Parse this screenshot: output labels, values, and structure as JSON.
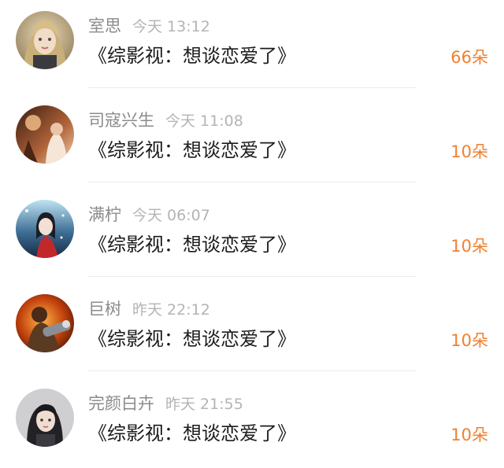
{
  "colors": {
    "name": "#8b8b8b",
    "time": "#b4b4b4",
    "title": "#1c1c1c",
    "gift_count": "#f08030",
    "divider": "#ececec"
  },
  "rows": [
    {
      "name": "室思",
      "time": "今天 13:12",
      "title": "《综影视：想谈恋爱了》",
      "gift": "66朵",
      "avatar_icon": "fantasy-girl-avatar-icon"
    },
    {
      "name": "司寇兴生",
      "time": "今天 11:08",
      "title": "《综影视：想谈恋爱了》",
      "gift": "10朵",
      "avatar_icon": "warm-scene-avatar-icon"
    },
    {
      "name": "满柠",
      "time": "今天 06:07",
      "title": "《综影视：想谈恋爱了》",
      "gift": "10朵",
      "avatar_icon": "girl-red-dress-avatar-icon"
    },
    {
      "name": "巨树",
      "time": "昨天 22:12",
      "title": "《综影视：想谈恋爱了》",
      "gift": "10朵",
      "avatar_icon": "warrior-game-avatar-icon"
    },
    {
      "name": "完颜白卉",
      "time": "昨天 21:55",
      "title": "《综影视：想谈恋爱了》",
      "gift": "10朵",
      "avatar_icon": "girl-portrait-avatar-icon"
    }
  ]
}
